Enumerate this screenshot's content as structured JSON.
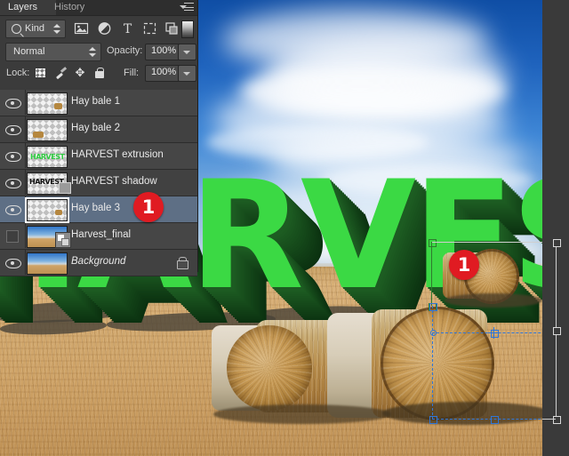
{
  "app": {
    "title": "Adobe Photoshop - Layers panel over harvest composition"
  },
  "panel": {
    "tabs": [
      {
        "id": "layers",
        "label": "Layers",
        "active": true
      },
      {
        "id": "history",
        "label": "History",
        "active": false
      }
    ],
    "menu_icon": "panel-menu-icon",
    "filter": {
      "kind_label": "Kind",
      "search_icon": "search-icon",
      "stepper_icon": "updown-stepper-icon",
      "type_filters": [
        {
          "id": "pixel",
          "icon": "image-filter-icon"
        },
        {
          "id": "adjustment",
          "icon": "adjustment-filter-icon"
        },
        {
          "id": "type",
          "icon": "type-filter-icon"
        },
        {
          "id": "shape",
          "icon": "shape-filter-icon"
        },
        {
          "id": "smart-object",
          "icon": "smart-object-filter-icon"
        }
      ],
      "toggle_icon": "filter-toggle-swatch"
    },
    "blend": {
      "mode": "Normal",
      "opacity_label": "Opacity:",
      "opacity_value": "100%"
    },
    "lock": {
      "label": "Lock:",
      "items": [
        {
          "id": "transparency",
          "icon": "lock-transparency-icon"
        },
        {
          "id": "image-pixels",
          "icon": "lock-pixels-brush-icon"
        },
        {
          "id": "position",
          "icon": "lock-position-move-icon"
        },
        {
          "id": "all",
          "icon": "lock-all-padlock-icon"
        }
      ],
      "fill_label": "Fill:",
      "fill_value": "100%"
    },
    "layers": [
      {
        "name": "Hay bale 1",
        "visible": true,
        "selected": false,
        "locked": false,
        "italic": false,
        "thumb": "transparent-bale-small"
      },
      {
        "name": "Hay bale 2",
        "visible": true,
        "selected": false,
        "locked": false,
        "italic": false,
        "thumb": "transparent-bale-small"
      },
      {
        "name": "HARVEST extrusion",
        "visible": true,
        "selected": false,
        "locked": false,
        "italic": false,
        "thumb": "transparent-green-text"
      },
      {
        "name": "HARVEST shadow",
        "visible": true,
        "selected": false,
        "locked": false,
        "italic": false,
        "thumb": "transparent-dark-text",
        "badge": "3d-cube-badge"
      },
      {
        "name": "Hay bale 3",
        "visible": true,
        "selected": true,
        "locked": false,
        "italic": false,
        "thumb": "transparent-bale-small"
      },
      {
        "name": "Harvest_final",
        "visible": false,
        "selected": false,
        "locked": false,
        "italic": false,
        "thumb": "photo-field",
        "badge": "smart-object-badge"
      },
      {
        "name": "Background",
        "visible": true,
        "selected": false,
        "locked": true,
        "italic": true,
        "thumb": "photo-field"
      }
    ]
  },
  "annotations": [
    {
      "id": "callout-layer",
      "label": "1",
      "target": "hay-bale-3-layer-row"
    },
    {
      "id": "callout-canvas",
      "label": "1",
      "target": "hay-bale-3-on-canvas"
    }
  ],
  "canvas": {
    "headline_text": "HARVEST",
    "selection": {
      "reference_point_icon": "transform-reference-point-icon",
      "handles_count": 8,
      "state": "free-transform-active"
    }
  },
  "colors": {
    "badge_red": "#e01b22",
    "text_green": "#3bd944",
    "extrusion_green": "#0b3110",
    "selected_row": "#5e6f85",
    "panel_bg": "#3b3b3b",
    "row_bg": "#464646",
    "sky_blue": "#1a4fa0",
    "field_tan": "#cfa468",
    "transform_blue": "#2f76d8"
  }
}
